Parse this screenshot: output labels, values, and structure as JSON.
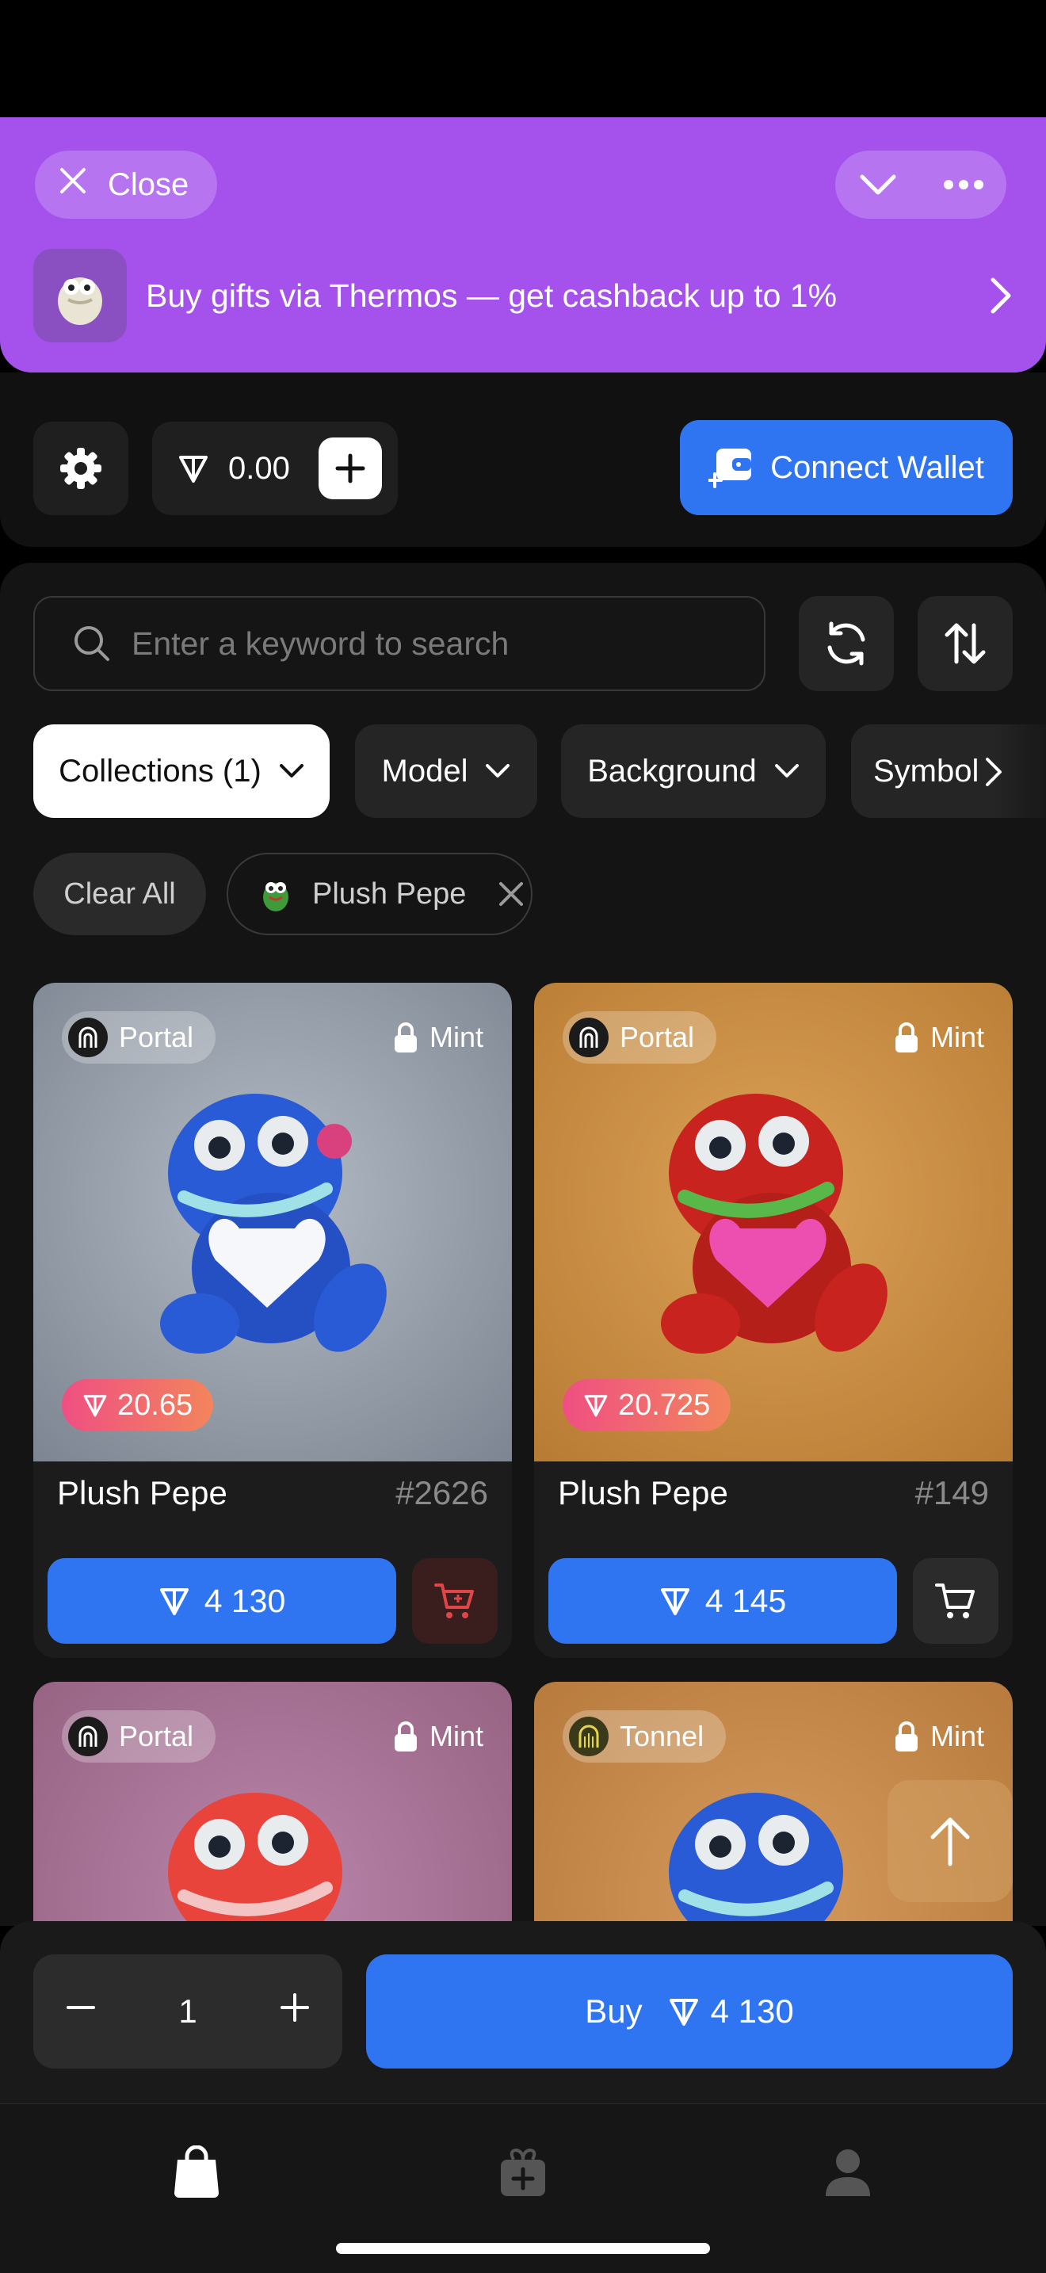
{
  "header": {
    "close_label": "Close",
    "promo_text": "Buy gifts via Thermos — get cashback up to 1%"
  },
  "wallet": {
    "balance": "0.00",
    "connect_label": "Connect Wallet"
  },
  "search": {
    "placeholder": "Enter a keyword to search"
  },
  "filters": {
    "collections": "Collections (1)",
    "model": "Model",
    "background": "Background",
    "symbol": "Symbol"
  },
  "active_filters": {
    "clear_label": "Clear All",
    "tags": [
      "Plush Pepe"
    ]
  },
  "cards": [
    {
      "source": "Portal",
      "mint": "Mint",
      "floor": "20.65",
      "title": "Plush Pepe",
      "number": "#2626",
      "price": "4 130",
      "bg": "#8e97a3",
      "frog": "#2a5bd6",
      "heart": "#ffffff"
    },
    {
      "source": "Portal",
      "mint": "Mint",
      "floor": "20.725",
      "title": "Plush Pepe",
      "number": "#149",
      "price": "4 145",
      "bg": "#c98a3c",
      "frog": "#c8231e",
      "heart": "#ec4fb0"
    },
    {
      "source": "Portal",
      "mint": "Mint",
      "bg": "#a77099",
      "frog": "#e8443c"
    },
    {
      "source": "Tonnel",
      "mint": "Mint",
      "bg": "#c58a4c",
      "frog": "#2a5bd6"
    }
  ],
  "purchase": {
    "quantity": "1",
    "buy_label": "Buy",
    "total": "4 130"
  },
  "icons": {
    "ton": "ton-icon",
    "close": "close-icon",
    "cart": "cart-icon"
  }
}
